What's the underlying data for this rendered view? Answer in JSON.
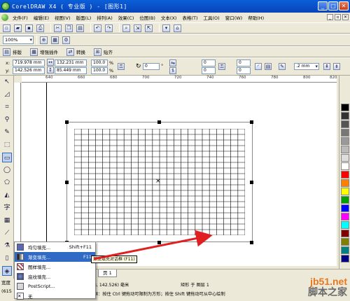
{
  "window": {
    "title": "CorelDRAW X4 ( 专业版 ) - [图形1]"
  },
  "menu": [
    "文件(F)",
    "编辑(E)",
    "视图(V)",
    "版面(L)",
    "排列(A)",
    "效果(C)",
    "位图(B)",
    "文本(X)",
    "表格(T)",
    "工具(O)",
    "窗口(W)",
    "帮助(H)"
  ],
  "zoom": "100%",
  "toolbar3": {
    "layout": "排版",
    "plugin": "增强插件",
    "convert": "转换",
    "paste": "贴齐"
  },
  "props": {
    "x": "719.978 mm",
    "y": "142.526 mm",
    "w": "132.231 mm",
    "h": "85.449 mm",
    "sx": "100.0",
    "sy": "100.0",
    "pct": "%",
    "rot": "0",
    "deg": "°",
    "c1": "0",
    "c2": "0",
    "c3": "0",
    "c4": "0",
    "outline": ".2 mm"
  },
  "ruler_ticks": [
    "640",
    "660",
    "680",
    "700",
    "720",
    "740",
    "760",
    "780",
    "800",
    "820"
  ],
  "flyout": [
    {
      "label": "均匀填充...",
      "shortcut": "Shift+F11"
    },
    {
      "label": "渐变填充...",
      "shortcut": "F11"
    },
    {
      "label": "图样填充...",
      "shortcut": ""
    },
    {
      "label": "底纹填充...",
      "shortcut": ""
    },
    {
      "label": "PostScript...",
      "shortcut": ""
    },
    {
      "label": "无",
      "shortcut": ""
    }
  ],
  "tooltip": "渐变填充对话框 (F11)",
  "status": {
    "page_tab": "页 1",
    "coords": "8, 142.526) 毫米",
    "object": "矩形 于 图层 1",
    "hint": "框：按住 Ctrl 键拖动可限制为方形；按住 Shift 键拖动可从中心绘制",
    "left1": "宽度",
    "left2": "(615"
  },
  "watermark": {
    "line1": "jb51.net",
    "line2": "脚本之家"
  },
  "colors": {
    "title_bar": "#0a5fd8",
    "highlight": "#316ac5",
    "arrow": "#e02020"
  },
  "palette": [
    "#000000",
    "#333333",
    "#555555",
    "#777777",
    "#999999",
    "#bbbbbb",
    "#dddddd",
    "#ffffff",
    "#ff0000",
    "#ff8000",
    "#ffff00",
    "#00a000",
    "#0000ff",
    "#ff00ff",
    "#00ffff",
    "#800000",
    "#808000",
    "#008080",
    "#000080"
  ]
}
